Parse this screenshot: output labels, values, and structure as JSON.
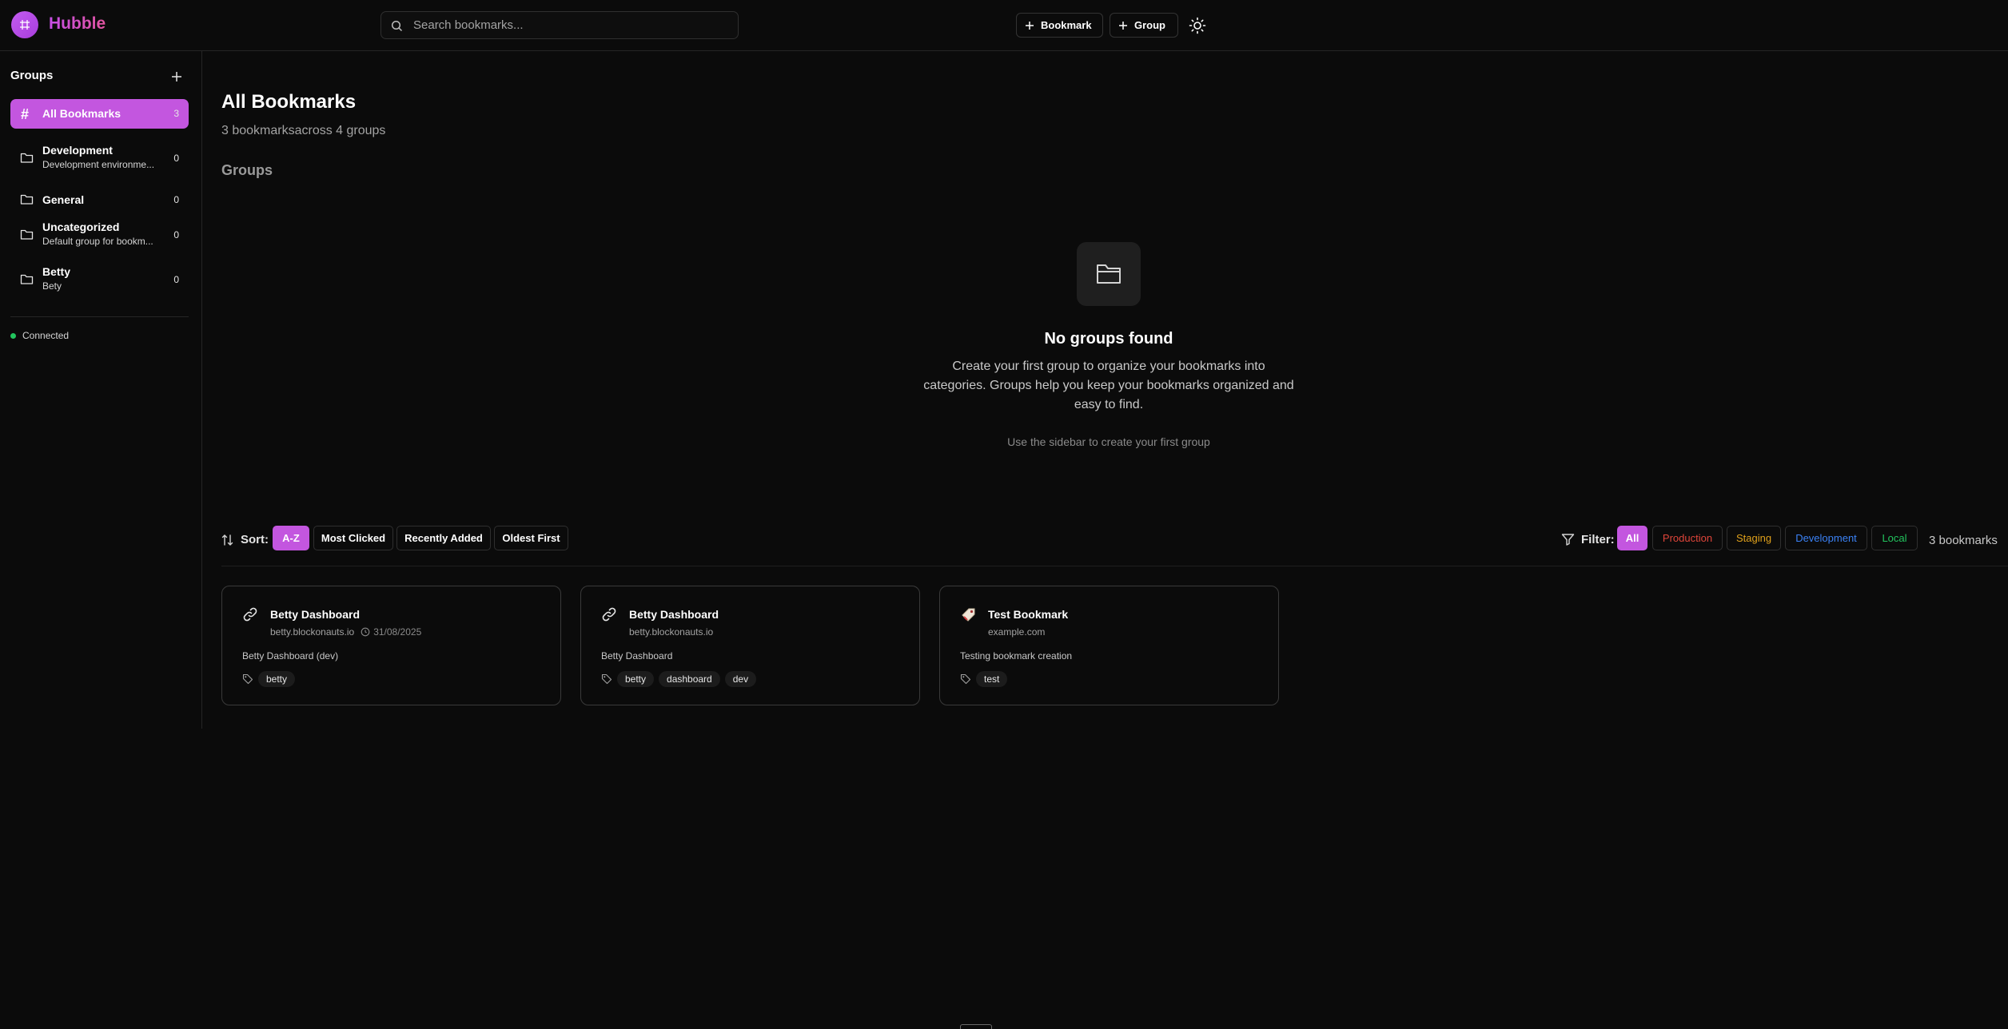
{
  "header": {
    "brand": "Hubble",
    "search_placeholder": "Search bookmarks...",
    "add_bookmark_label": "Bookmark",
    "add_group_label": "Group"
  },
  "sidebar": {
    "title": "Groups",
    "items": [
      {
        "label": "All Bookmarks",
        "count": "3"
      },
      {
        "label": "Development",
        "subtitle": "Development environme...",
        "count": "0"
      },
      {
        "label": "General",
        "count": "0"
      },
      {
        "label": "Uncategorized",
        "subtitle": "Default group for bookm...",
        "count": "0"
      },
      {
        "label": "Betty",
        "subtitle": "Bety",
        "count": "0"
      }
    ],
    "status": "Connected"
  },
  "main": {
    "title": "All Bookmarks",
    "subtitle": "3 bookmarksacross 4 groups",
    "groups_heading": "Groups",
    "empty": {
      "title": "No groups found",
      "description": "Create your first group to organize your bookmarks into categories. Groups help you keep your bookmarks organized and easy to find.",
      "hint": "Use the sidebar to create your first group"
    },
    "sort": {
      "label": "Sort:",
      "options": [
        "A-Z",
        "Most Clicked",
        "Recently Added",
        "Oldest First"
      ],
      "selected": "A-Z"
    },
    "filter": {
      "label": "Filter:",
      "options": [
        {
          "label": "All",
          "color": "#ffffff"
        },
        {
          "label": "Production",
          "color": "#e0453a"
        },
        {
          "label": "Staging",
          "color": "#e0a11b"
        },
        {
          "label": "Development",
          "color": "#3b82f6"
        },
        {
          "label": "Local",
          "color": "#22c55e"
        }
      ],
      "selected": "All"
    },
    "count_label": "3 bookmarks",
    "bookmarks": [
      {
        "title": "Betty Dashboard",
        "domain": "betty.blockonauts.io",
        "date": "31/08/2025",
        "description": "Betty Dashboard (dev)",
        "tags": [
          "betty"
        ],
        "icon": "link-icon"
      },
      {
        "title": "Betty Dashboard",
        "domain": "betty.blockonauts.io",
        "description": "Betty Dashboard",
        "tags": [
          "betty",
          "dashboard",
          "dev"
        ],
        "icon": "link-icon"
      },
      {
        "title": "Test Bookmark",
        "domain": "example.com",
        "description": "Testing bookmark creation",
        "tags": [
          "test"
        ],
        "icon": "bookmark-tag-icon"
      }
    ]
  },
  "colors": {
    "accent": "#c356df",
    "background": "#0b0b0b",
    "status_ok": "#22c55e"
  }
}
